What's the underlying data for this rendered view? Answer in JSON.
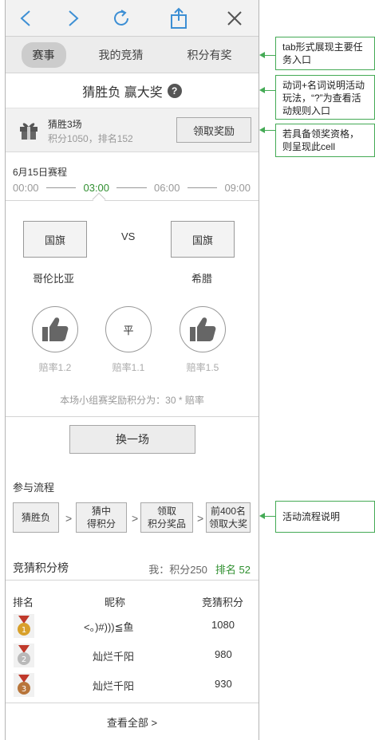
{
  "tabs": [
    {
      "label": "赛事",
      "active": true
    },
    {
      "label": "我的竞猜",
      "active": false
    },
    {
      "label": "积分有奖",
      "active": false
    }
  ],
  "headline": {
    "text": "猜胜负 赢大奖",
    "help": "?"
  },
  "reward": {
    "title": "猜胜3场",
    "subtitle": "积分1050，排名152",
    "button": "领取奖励"
  },
  "schedule": {
    "date": "6月15日赛程",
    "times": [
      {
        "label": "00:00",
        "active": false
      },
      {
        "label": "03:00",
        "active": true
      },
      {
        "label": "06:00",
        "active": false
      },
      {
        "label": "09:00",
        "active": false
      }
    ]
  },
  "match": {
    "vs": "VS",
    "home": {
      "flag": "国旗",
      "name": "哥伦比亚",
      "odds": "赔率1.2"
    },
    "draw": {
      "label": "平",
      "odds": "赔率1.1"
    },
    "away": {
      "flag": "国旗",
      "name": "希腊",
      "odds": "赔率1.5"
    },
    "note": "本场小组赛奖励积分为：30 * 赔率"
  },
  "change_button": "换一场",
  "process": {
    "title": "参与流程",
    "steps": [
      "猜胜负",
      "猜中\n得积分",
      "领取\n积分奖品",
      "前400名\n领取大奖"
    ]
  },
  "leaderboard": {
    "title": "竞猜积分榜",
    "me_label": "我：积分250",
    "me_rank": "排名 52",
    "columns": [
      "排名",
      "昵称",
      "竞猜积分"
    ],
    "rows": [
      {
        "medal": "1",
        "medal_color": "#d8a02a",
        "name": "<。)#)))≦鱼",
        "score": "1080"
      },
      {
        "medal": "2",
        "medal_color": "#b9b9b9",
        "name": "灿烂千阳",
        "score": "980"
      },
      {
        "medal": "3",
        "medal_color": "#b8753a",
        "name": "灿烂千阳",
        "score": "930"
      }
    ],
    "view_all": "查看全部 >"
  },
  "annotations": [
    "tab形式展现主要任务入口",
    "动词+名词说明活动玩法，“?”为查看活动规则入口",
    "若具备领奖资格，则呈现此cell",
    "活动流程说明"
  ],
  "colors": {
    "accent_blue": "#3d8fd4",
    "accent_green": "#2f8f2f",
    "annotation_green": "#44aa55"
  }
}
